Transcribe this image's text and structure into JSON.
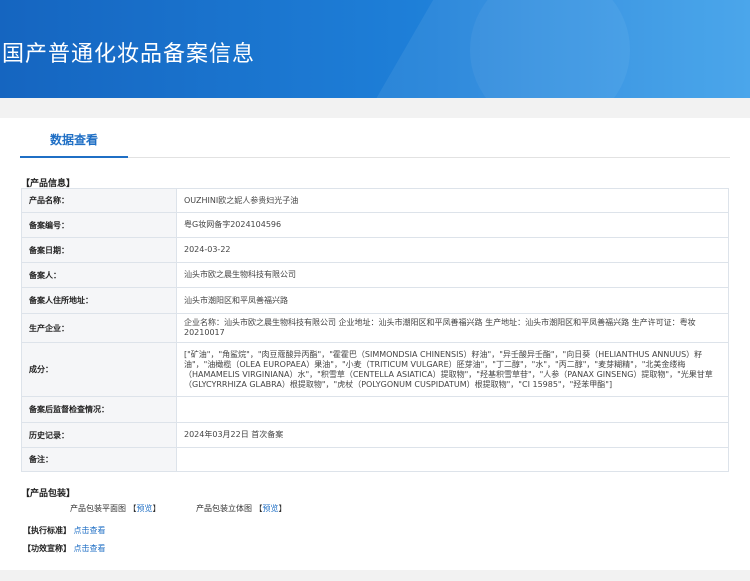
{
  "header": {
    "title": "国产普通化妆品备案信息"
  },
  "tabs": [
    {
      "label": "数据查看",
      "active": true
    }
  ],
  "product_info": {
    "section_title": "【产品信息】",
    "rows": [
      {
        "label": "产品名称：",
        "value": "OUZHINI欧之妮人参贵妇光子油"
      },
      {
        "label": "备案编号：",
        "value": "粤G妆网备字2024104596"
      },
      {
        "label": "备案日期：",
        "value": "2024-03-22"
      },
      {
        "label": "备案人：",
        "value": "汕头市欧之晨生物科技有限公司"
      },
      {
        "label": "备案人住所地址：",
        "value": "汕头市潮阳区和平凤善福兴路"
      },
      {
        "label": "生产企业：",
        "value": "企业名称：汕头市欧之晨生物科技有限公司 企业地址：汕头市潮阳区和平凤善福兴路 生产地址：汕头市潮阳区和平凤善福兴路 生产许可证：粤妆20210017"
      },
      {
        "label": "成分：",
        "value": "[\"矿油\"，\"角鲨烷\"，\"肉豆蔻酸异丙酯\"，\"霍霍巴（SIMMONDSIA CHINENSIS）籽油\"，\"异壬酸异壬酯\"，\"向日葵（HELIANTHUS ANNUUS）籽油\"，\"油橄榄（OLEA EUROPAEA）果油\"，\"小麦（TRITICUM VULGARE）胚芽油\"，\"丁二醇\"，\"水\"，\"丙二醇\"，\"麦芽糊精\"，\"北美金缕梅（HAMAMELIS VIRGINIANA）水\"，\"积雪草（CENTELLA ASIATICA）提取物\"，\"羟基积雪草苷\"，\"人参（PANAX GINSENG）提取物\"，\"光果甘草（GLYCYRRHIZA GLABRA）根提取物\"，\"虎杖（POLYGONUM CUSPIDATUM）根提取物\"，\"CI 15985\"，\"羟苯甲酯\"]"
      },
      {
        "label": "备案后监督检查情况：",
        "value": ""
      },
      {
        "label": "历史记录：",
        "value": "2024年03月22日 首次备案"
      },
      {
        "label": "备注：",
        "value": ""
      }
    ]
  },
  "packaging": {
    "section_title": "【产品包装】",
    "items": [
      {
        "label": "产品包装平面图",
        "link": "预览",
        "open": "【",
        "close": "】"
      },
      {
        "label": "产品包装立体图",
        "link": "预览",
        "open": "【",
        "close": "】"
      }
    ]
  },
  "standard": {
    "label": "【执行标准】",
    "link": "点击查看"
  },
  "efficacy": {
    "label": "【功效宣称】",
    "link": "点击查看"
  },
  "colors": {
    "banner": "#1e7fd8",
    "accent": "#1f6fc5",
    "label_bg": "#f5f6f8"
  }
}
